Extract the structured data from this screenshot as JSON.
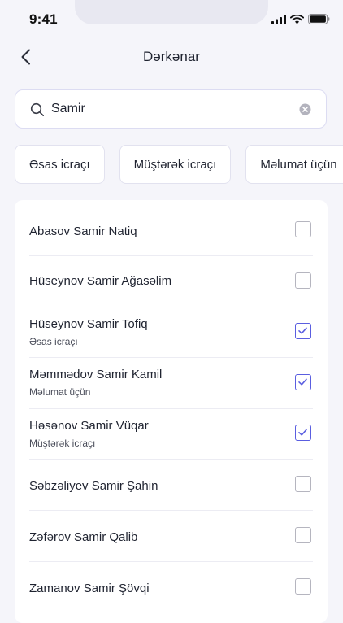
{
  "status_bar": {
    "time": "9:41"
  },
  "header": {
    "title": "Dərkənar"
  },
  "search": {
    "value": "Samir",
    "placeholder": ""
  },
  "chips": [
    {
      "label": "Əsas icraçı"
    },
    {
      "label": "Müştərək icraçı"
    },
    {
      "label": "Məlumat üçün"
    }
  ],
  "people": [
    {
      "name": "Abasov Samir Natiq",
      "role": "",
      "checked": false
    },
    {
      "name": "Hüseynov Samir Ağasəlim",
      "role": "",
      "checked": false
    },
    {
      "name": "Hüseynov Samir Tofiq",
      "role": "Əsas icraçı",
      "checked": true
    },
    {
      "name": "Məmmədov Samir Kamil",
      "role": "Məlumat üçün",
      "checked": true
    },
    {
      "name": "Həsənov Samir Vüqar",
      "role": "Müştərək icraçı",
      "checked": true
    },
    {
      "name": "Səbzəliyev Samir Şahin",
      "role": "",
      "checked": false
    },
    {
      "name": "Zəfərov Samir Qalib",
      "role": "",
      "checked": false
    },
    {
      "name": "Zamanov Samir Şövqi",
      "role": "",
      "checked": false
    }
  ],
  "colors": {
    "accent": "#5a5ee0",
    "background": "#f5f5fa",
    "card": "#ffffff"
  },
  "icons": {
    "back": "chevron-left-icon",
    "search": "search-icon",
    "clear": "clear-icon",
    "checkbox": "checkbox-icon"
  }
}
